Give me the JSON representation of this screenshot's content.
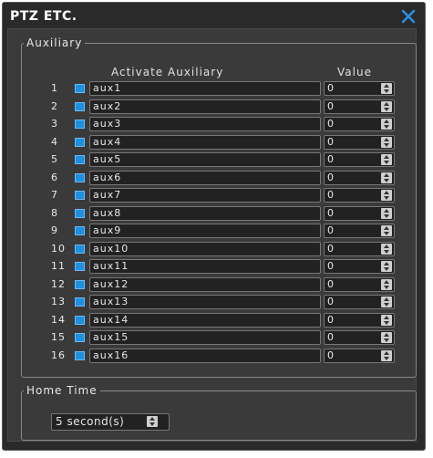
{
  "window": {
    "title": "PTZ ETC."
  },
  "icons": {
    "close": "close-icon",
    "spinner": "up-down-spinner-icon"
  },
  "colors": {
    "accent": "#1e90e0",
    "background": "#2a2a2a",
    "panel": "#3a3a3a"
  },
  "auxiliary": {
    "legend": "Auxiliary",
    "header_activate": "Activate Auxiliary",
    "header_value": "Value",
    "rows": [
      {
        "num": "1",
        "name": "aux1",
        "value": "0",
        "checked": true
      },
      {
        "num": "2",
        "name": "aux2",
        "value": "0",
        "checked": true
      },
      {
        "num": "3",
        "name": "aux3",
        "value": "0",
        "checked": true
      },
      {
        "num": "4",
        "name": "aux4",
        "value": "0",
        "checked": true
      },
      {
        "num": "5",
        "name": "aux5",
        "value": "0",
        "checked": true
      },
      {
        "num": "6",
        "name": "aux6",
        "value": "0",
        "checked": true
      },
      {
        "num": "7",
        "name": "aux7",
        "value": "0",
        "checked": true
      },
      {
        "num": "8",
        "name": "aux8",
        "value": "0",
        "checked": true
      },
      {
        "num": "9",
        "name": "aux9",
        "value": "0",
        "checked": true
      },
      {
        "num": "10",
        "name": "aux10",
        "value": "0",
        "checked": true
      },
      {
        "num": "11",
        "name": "aux11",
        "value": "0",
        "checked": true
      },
      {
        "num": "12",
        "name": "aux12",
        "value": "0",
        "checked": true
      },
      {
        "num": "13",
        "name": "aux13",
        "value": "0",
        "checked": true
      },
      {
        "num": "14",
        "name": "aux14",
        "value": "0",
        "checked": true
      },
      {
        "num": "15",
        "name": "aux15",
        "value": "0",
        "checked": true
      },
      {
        "num": "16",
        "name": "aux16",
        "value": "0",
        "checked": true
      }
    ]
  },
  "home_time": {
    "legend": "Home Time",
    "value": "5 second(s)"
  }
}
